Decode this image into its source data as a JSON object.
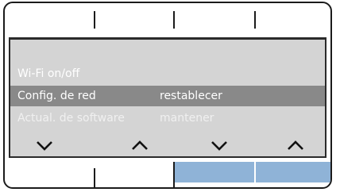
{
  "menu": {
    "rows": [
      {
        "label": "Wi-Fi on/off",
        "value": "",
        "state": "dim"
      },
      {
        "label": "Config. de red",
        "value": "restablecer",
        "state": "selected"
      },
      {
        "label": "Actual. de software",
        "value": "mantener",
        "state": "disabled"
      }
    ]
  },
  "softkeys": {
    "arrows": [
      "chevron-down-icon",
      "chevron-up-icon",
      "chevron-down-icon",
      "chevron-up-icon"
    ],
    "bottom_active_color": "#8fb3d7"
  },
  "colors": {
    "screen_bg": "#d4d4d4",
    "selected_bg": "#898989",
    "frame": "#1b1b1b"
  }
}
